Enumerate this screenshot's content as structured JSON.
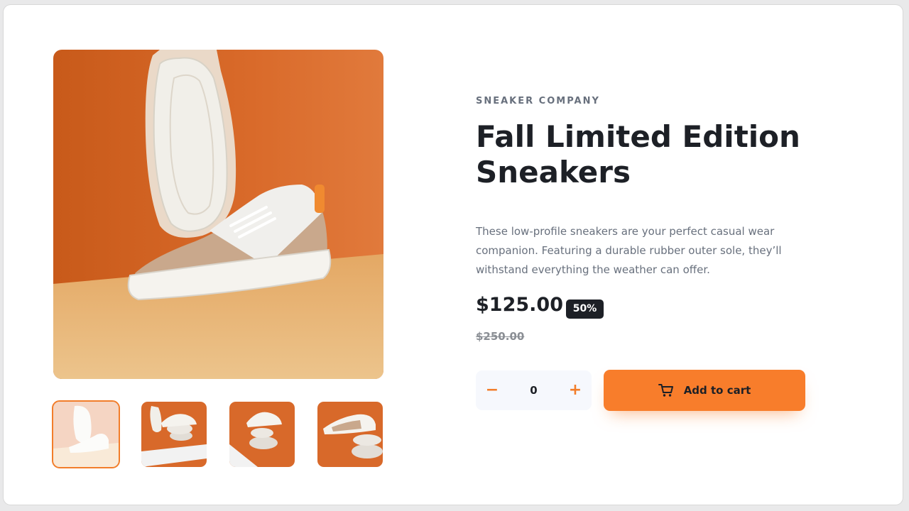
{
  "product": {
    "company": "SNEAKER COMPANY",
    "title": "Fall Limited Edition Sneakers",
    "description": "These low-profile sneakers are your perfect casual wear companion. Featuring a durable rubber outer sole, they’ll withstand everything the weather can offer.",
    "price": "$125.00",
    "discount": "50%",
    "original_price": "$250.00"
  },
  "cart": {
    "quantity": "0",
    "minus_icon": "minus-icon",
    "plus_icon": "plus-icon",
    "cart_icon": "cart-icon",
    "add_label": "Add to cart"
  },
  "gallery": {
    "main_image": "product-image-1",
    "thumbnails": [
      "thumbnail-1",
      "thumbnail-2",
      "thumbnail-3",
      "thumbnail-4"
    ],
    "active_thumbnail_index": 0
  },
  "colors": {
    "accent": "#f87d2b",
    "dark": "#1d2026",
    "muted": "#68707d",
    "light_bg": "#f6f8fd",
    "image_orange": "#d2691e",
    "image_floor": "#e8b573"
  }
}
